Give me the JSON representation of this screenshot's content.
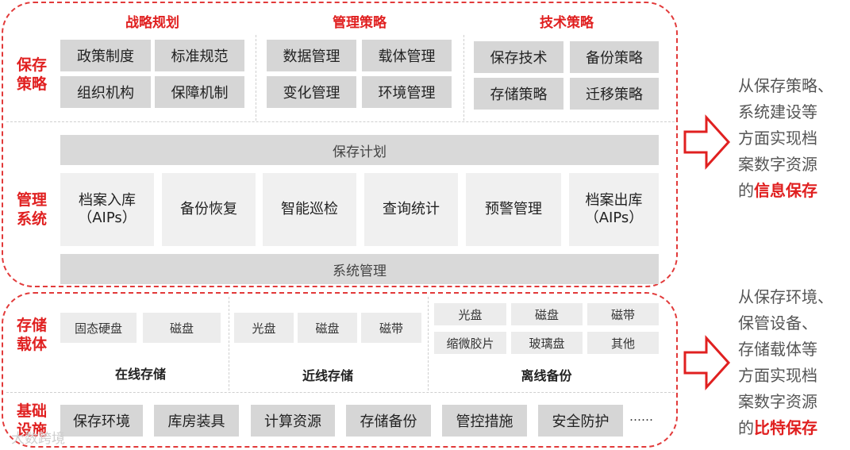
{
  "upper": {
    "preservation_label": "保存\n策略",
    "management_label": "管理\n系统",
    "columns": [
      {
        "title": "战略规划",
        "items": [
          "政策制度",
          "标准规范",
          "组织机构",
          "保障机制"
        ]
      },
      {
        "title": "管理策略",
        "items": [
          "数据管理",
          "载体管理",
          "变化管理",
          "环境管理"
        ]
      },
      {
        "title": "技术策略",
        "items": [
          "保存技术",
          "备份策略",
          "存储策略",
          "迁移策略"
        ]
      }
    ],
    "plan_bar": "保存计划",
    "modules": [
      "档案入库\n（AIPs）",
      "备份恢复",
      "智能巡检",
      "查询统计",
      "预警管理",
      "档案出库\n（AIPs）"
    ],
    "system_bar": "系统管理"
  },
  "lower": {
    "carrier_label": "存储\n载体",
    "infra_label": "基础\n设施",
    "groups": [
      {
        "title": "在线存储",
        "items": [
          "固态硬盘",
          "磁盘"
        ]
      },
      {
        "title": "近线存储",
        "items": [
          "光盘",
          "磁盘",
          "磁带"
        ]
      },
      {
        "title": "离线备份",
        "items": [
          "光盘",
          "磁盘",
          "磁带",
          "缩微胶片",
          "玻璃盘",
          "其他"
        ]
      }
    ],
    "infra_items": [
      "保存环境",
      "库房装具",
      "计算资源",
      "存储备份",
      "管控措施",
      "安全防护"
    ],
    "infra_more": "……"
  },
  "side": {
    "top": {
      "lines": [
        "从保存策略、",
        "系统建设等",
        "方面实现档",
        "案数字资源"
      ],
      "prefix": "的",
      "emphasis": "信息保存"
    },
    "bottom": {
      "lines": [
        "从保存环境、",
        "保管设备、",
        "存储载体等",
        "方面实现档",
        "案数字资源"
      ],
      "prefix": "的",
      "emphasis": "比特保存"
    }
  },
  "watermark": "大数跨境",
  "colors": {
    "accent": "#e02020",
    "box": "#d6d6d6",
    "light_box": "#f0f0f0"
  }
}
